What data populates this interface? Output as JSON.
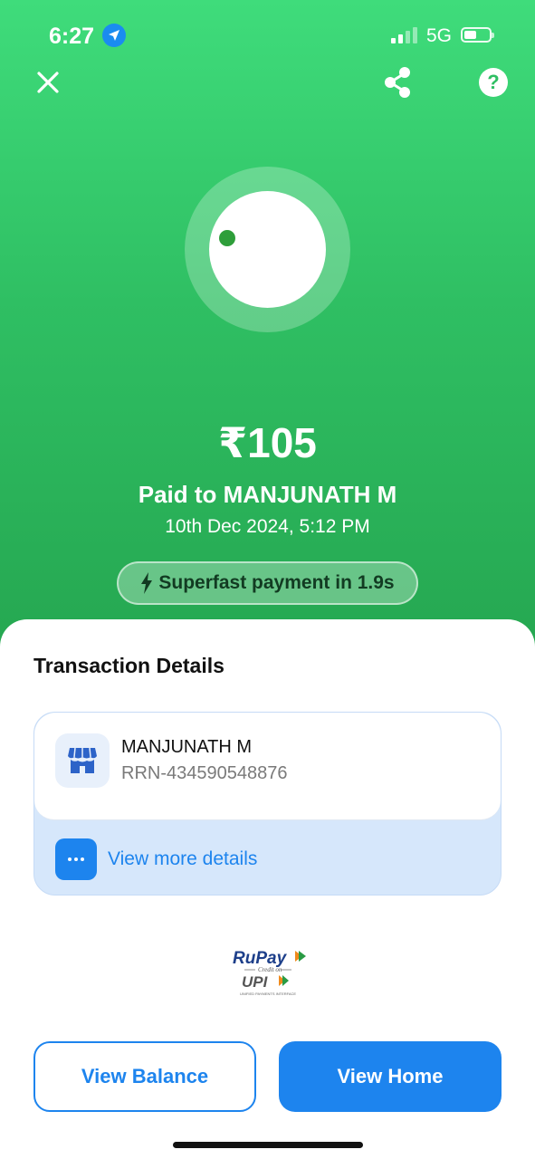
{
  "status_bar": {
    "time": "6:27",
    "network": "5G"
  },
  "header": {
    "close_icon": "close-icon",
    "share_icon": "share-icon",
    "help_label": "?"
  },
  "payment": {
    "amount": "₹105",
    "paid_to": "Paid to MANJUNATH M",
    "date": "10th Dec 2024, 5:12 PM",
    "speed_text": "Superfast payment in 1.9s"
  },
  "details": {
    "title": "Transaction Details",
    "merchant_name": "MANJUNATH M",
    "rrn": "RRN-434590548876",
    "view_more_label": "View more details"
  },
  "brand": {
    "rupay": "RuPay",
    "credit_on": "Credit on",
    "upi": "UPI",
    "upi_sub": "UNIFIED PAYMENTS INTERFACE"
  },
  "actions": {
    "view_balance": "View Balance",
    "view_home": "View Home"
  },
  "colors": {
    "hero_green": "#2fbf63",
    "accent_blue": "#1d84ee",
    "card_blue": "#d6e7fb"
  }
}
